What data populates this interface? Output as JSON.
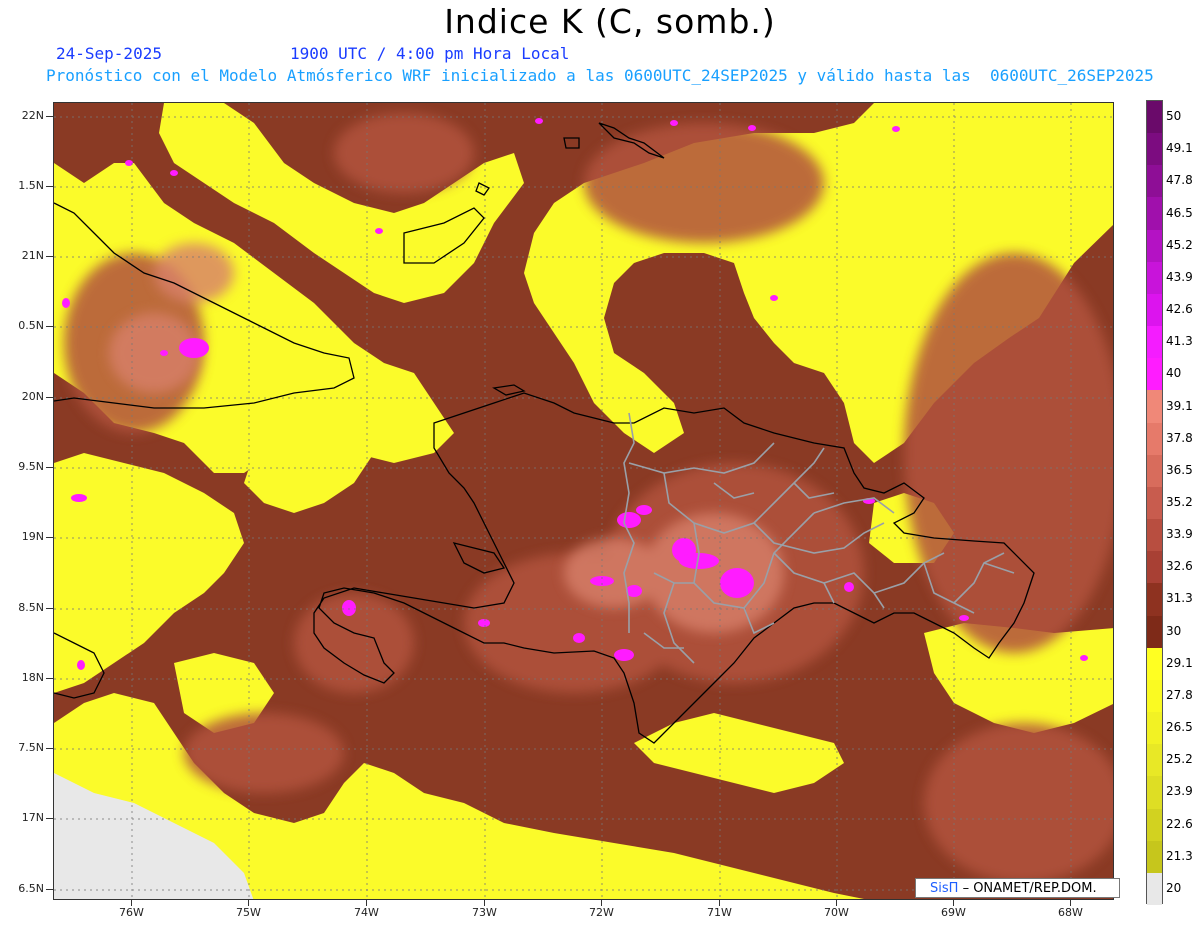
{
  "header": {
    "title": "Indice K (C, somb.)",
    "date": "24-Sep-2025",
    "time": "1900 UTC / 4:00 pm Hora Local",
    "subtitle": "Pronóstico con el Modelo Atmósferico WRF inicializado a las 0600UTC_24SEP2025 y válido hasta las  0600UTC_26SEP2025"
  },
  "axes": {
    "lat_labels": [
      "22N",
      "1.5N",
      "21N",
      "0.5N",
      "20N",
      "9.5N",
      "19N",
      "8.5N",
      "18N",
      "7.5N",
      "17N",
      "6.5N"
    ],
    "lon_labels": [
      "76W",
      "75W",
      "74W",
      "73W",
      "72W",
      "71W",
      "70W",
      "69W",
      "68W"
    ]
  },
  "colorbar": {
    "labels": [
      "50",
      "49.1",
      "47.8",
      "46.5",
      "45.2",
      "43.9",
      "42.6",
      "41.3",
      "40",
      "39.1",
      "37.8",
      "36.5",
      "35.2",
      "33.9",
      "32.6",
      "31.3",
      "30",
      "29.1",
      "27.8",
      "26.5",
      "25.2",
      "23.9",
      "22.6",
      "21.3",
      "20"
    ],
    "colors": [
      "#6a0a6a",
      "#7c0c80",
      "#8e0e96",
      "#a010ac",
      "#b412c4",
      "#c814da",
      "#dc14ee",
      "#f41cff",
      "#ff1cff",
      "#f08878",
      "#e67a6a",
      "#d86c5c",
      "#c85c4e",
      "#b84e40",
      "#a84034",
      "#8e3220",
      "#7e2a18",
      "#ffff22",
      "#fafa22",
      "#f2f224",
      "#e8e826",
      "#dede24",
      "#d2d220",
      "#c6c61c",
      "#e8e8e8"
    ]
  },
  "credit": {
    "brand": "SisΠ",
    "org": "– ONAMET/REP.DOM."
  }
}
